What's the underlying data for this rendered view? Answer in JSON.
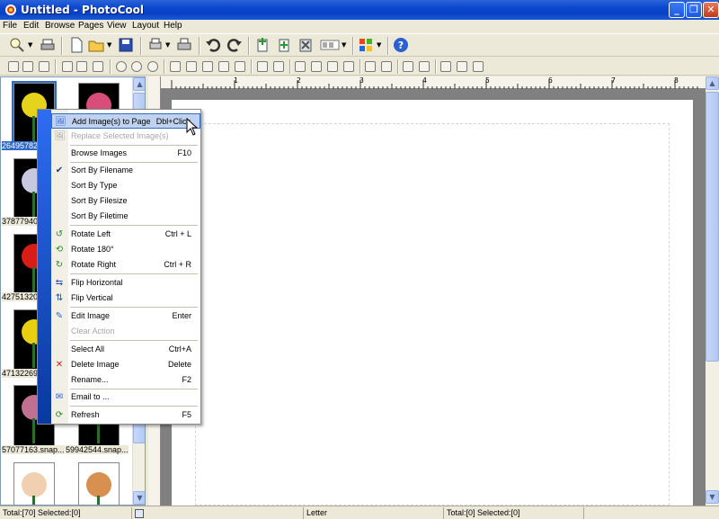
{
  "window": {
    "title": "Untitled - PhotoCool"
  },
  "menubar": [
    "File",
    "Edit",
    "Browse",
    "Pages",
    "View",
    "Layout",
    "Help"
  ],
  "thumbnails": {
    "labels": [
      "26495782",
      "37877940",
      "42751320",
      "47132269",
      "57077163.snap...",
      "59942544.snap..."
    ],
    "flower_colors": [
      "#e6d31b",
      "#d94d7a",
      "#c8c8e0",
      "#b0a880",
      "#d81d16",
      "#e0d0c0",
      "#e8d010",
      "#e0a040",
      "#c07090",
      "#e8c020",
      "#f0d0b0",
      "#d89050"
    ]
  },
  "ruler": {
    "numbers": [
      "1",
      "2",
      "3",
      "4",
      "5",
      "6",
      "7",
      "8"
    ]
  },
  "context_menu": {
    "sidebar_label": "PhotoCool 1.55",
    "items": [
      {
        "label": "Add Image(s) to Page",
        "accel": "Dbl+Click",
        "icon": "add-image-icon",
        "state": "highlighted"
      },
      {
        "label": "Replace Selected Image(s)",
        "accel": "",
        "icon": "replace-image-icon",
        "state": "disabled"
      },
      {
        "label": "Browse Images",
        "accel": "F10",
        "icon": "",
        "state": "normal"
      },
      {
        "label": "Sort By Filename",
        "accel": "",
        "icon": "check-icon",
        "state": "checked"
      },
      {
        "label": "Sort By Type",
        "accel": "",
        "icon": "",
        "state": "normal"
      },
      {
        "label": "Sort By Filesize",
        "accel": "",
        "icon": "",
        "state": "normal"
      },
      {
        "label": "Sort By Filetime",
        "accel": "",
        "icon": "",
        "state": "normal"
      },
      {
        "label": "Rotate Left",
        "accel": "Ctrl + L",
        "icon": "rotate-left-icon",
        "state": "normal"
      },
      {
        "label": "Rotate 180°",
        "accel": "",
        "icon": "rotate-180-icon",
        "state": "normal"
      },
      {
        "label": "Rotate Right",
        "accel": "Ctrl + R",
        "icon": "rotate-right-icon",
        "state": "normal"
      },
      {
        "label": "Flip Horizontal",
        "accel": "",
        "icon": "flip-horizontal-icon",
        "state": "normal"
      },
      {
        "label": "Flip Vertical",
        "accel": "",
        "icon": "flip-vertical-icon",
        "state": "normal"
      },
      {
        "label": "Edit Image",
        "accel": "Enter",
        "icon": "edit-image-icon",
        "state": "normal"
      },
      {
        "label": "Clear Action",
        "accel": "",
        "icon": "",
        "state": "disabled"
      },
      {
        "label": "Select All",
        "accel": "Ctrl+A",
        "icon": "",
        "state": "normal"
      },
      {
        "label": "Delete Image",
        "accel": "Delete",
        "icon": "delete-icon",
        "state": "normal"
      },
      {
        "label": "Rename...",
        "accel": "F2",
        "icon": "",
        "state": "normal"
      },
      {
        "label": "Email to ...",
        "accel": "",
        "icon": "email-icon",
        "state": "normal"
      },
      {
        "label": "Refresh",
        "accel": "F5",
        "icon": "refresh-icon",
        "state": "normal"
      }
    ]
  },
  "statusbar": {
    "total": "Total:[70] Selected:[0]",
    "paper": "Letter",
    "page_total": "Total:[0] Selected:[0]"
  },
  "colors": {
    "titlebar": "#0a46d0",
    "menu_sidebar": "#2d6df1",
    "highlight": "#c1d2ee"
  }
}
